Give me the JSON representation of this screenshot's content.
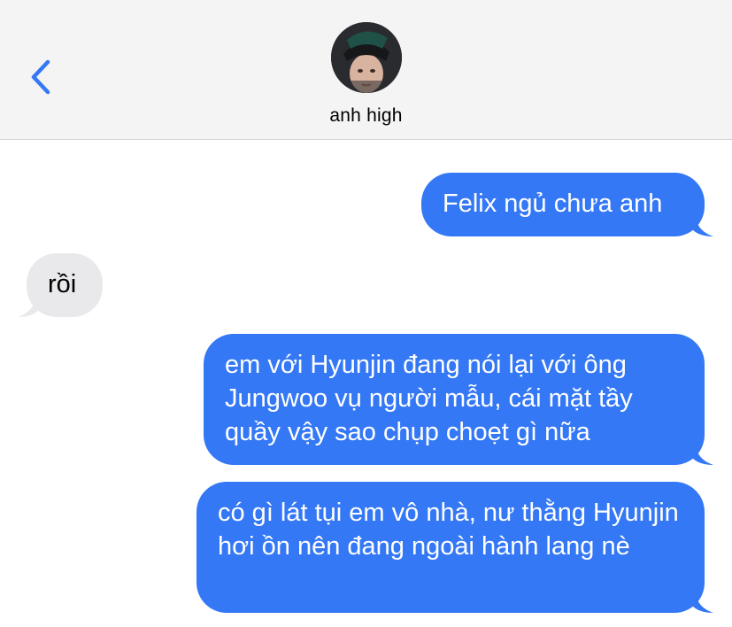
{
  "header": {
    "contact_name": "anh high",
    "back_icon": "chevron-left-icon",
    "accent_color": "#3478f6"
  },
  "messages": [
    {
      "direction": "outgoing",
      "text": "Felix ngủ chưa anh"
    },
    {
      "direction": "incoming",
      "text": "rồi"
    },
    {
      "direction": "outgoing",
      "text": "em với Hyunjin đang nói lại với ông Jungwoo vụ người mẫu, cái mặt tầy quầy vậy sao chụp choẹt gì nữa"
    },
    {
      "direction": "outgoing",
      "text": "có gì lát tụi em vô nhà, nư thằng Hyunjin hơi ồn nên đang ngoài hành lang nè"
    }
  ],
  "colors": {
    "outgoing_bubble": "#3478f6",
    "incoming_bubble": "#e9e9eb",
    "header_background": "#f4f4f4"
  }
}
